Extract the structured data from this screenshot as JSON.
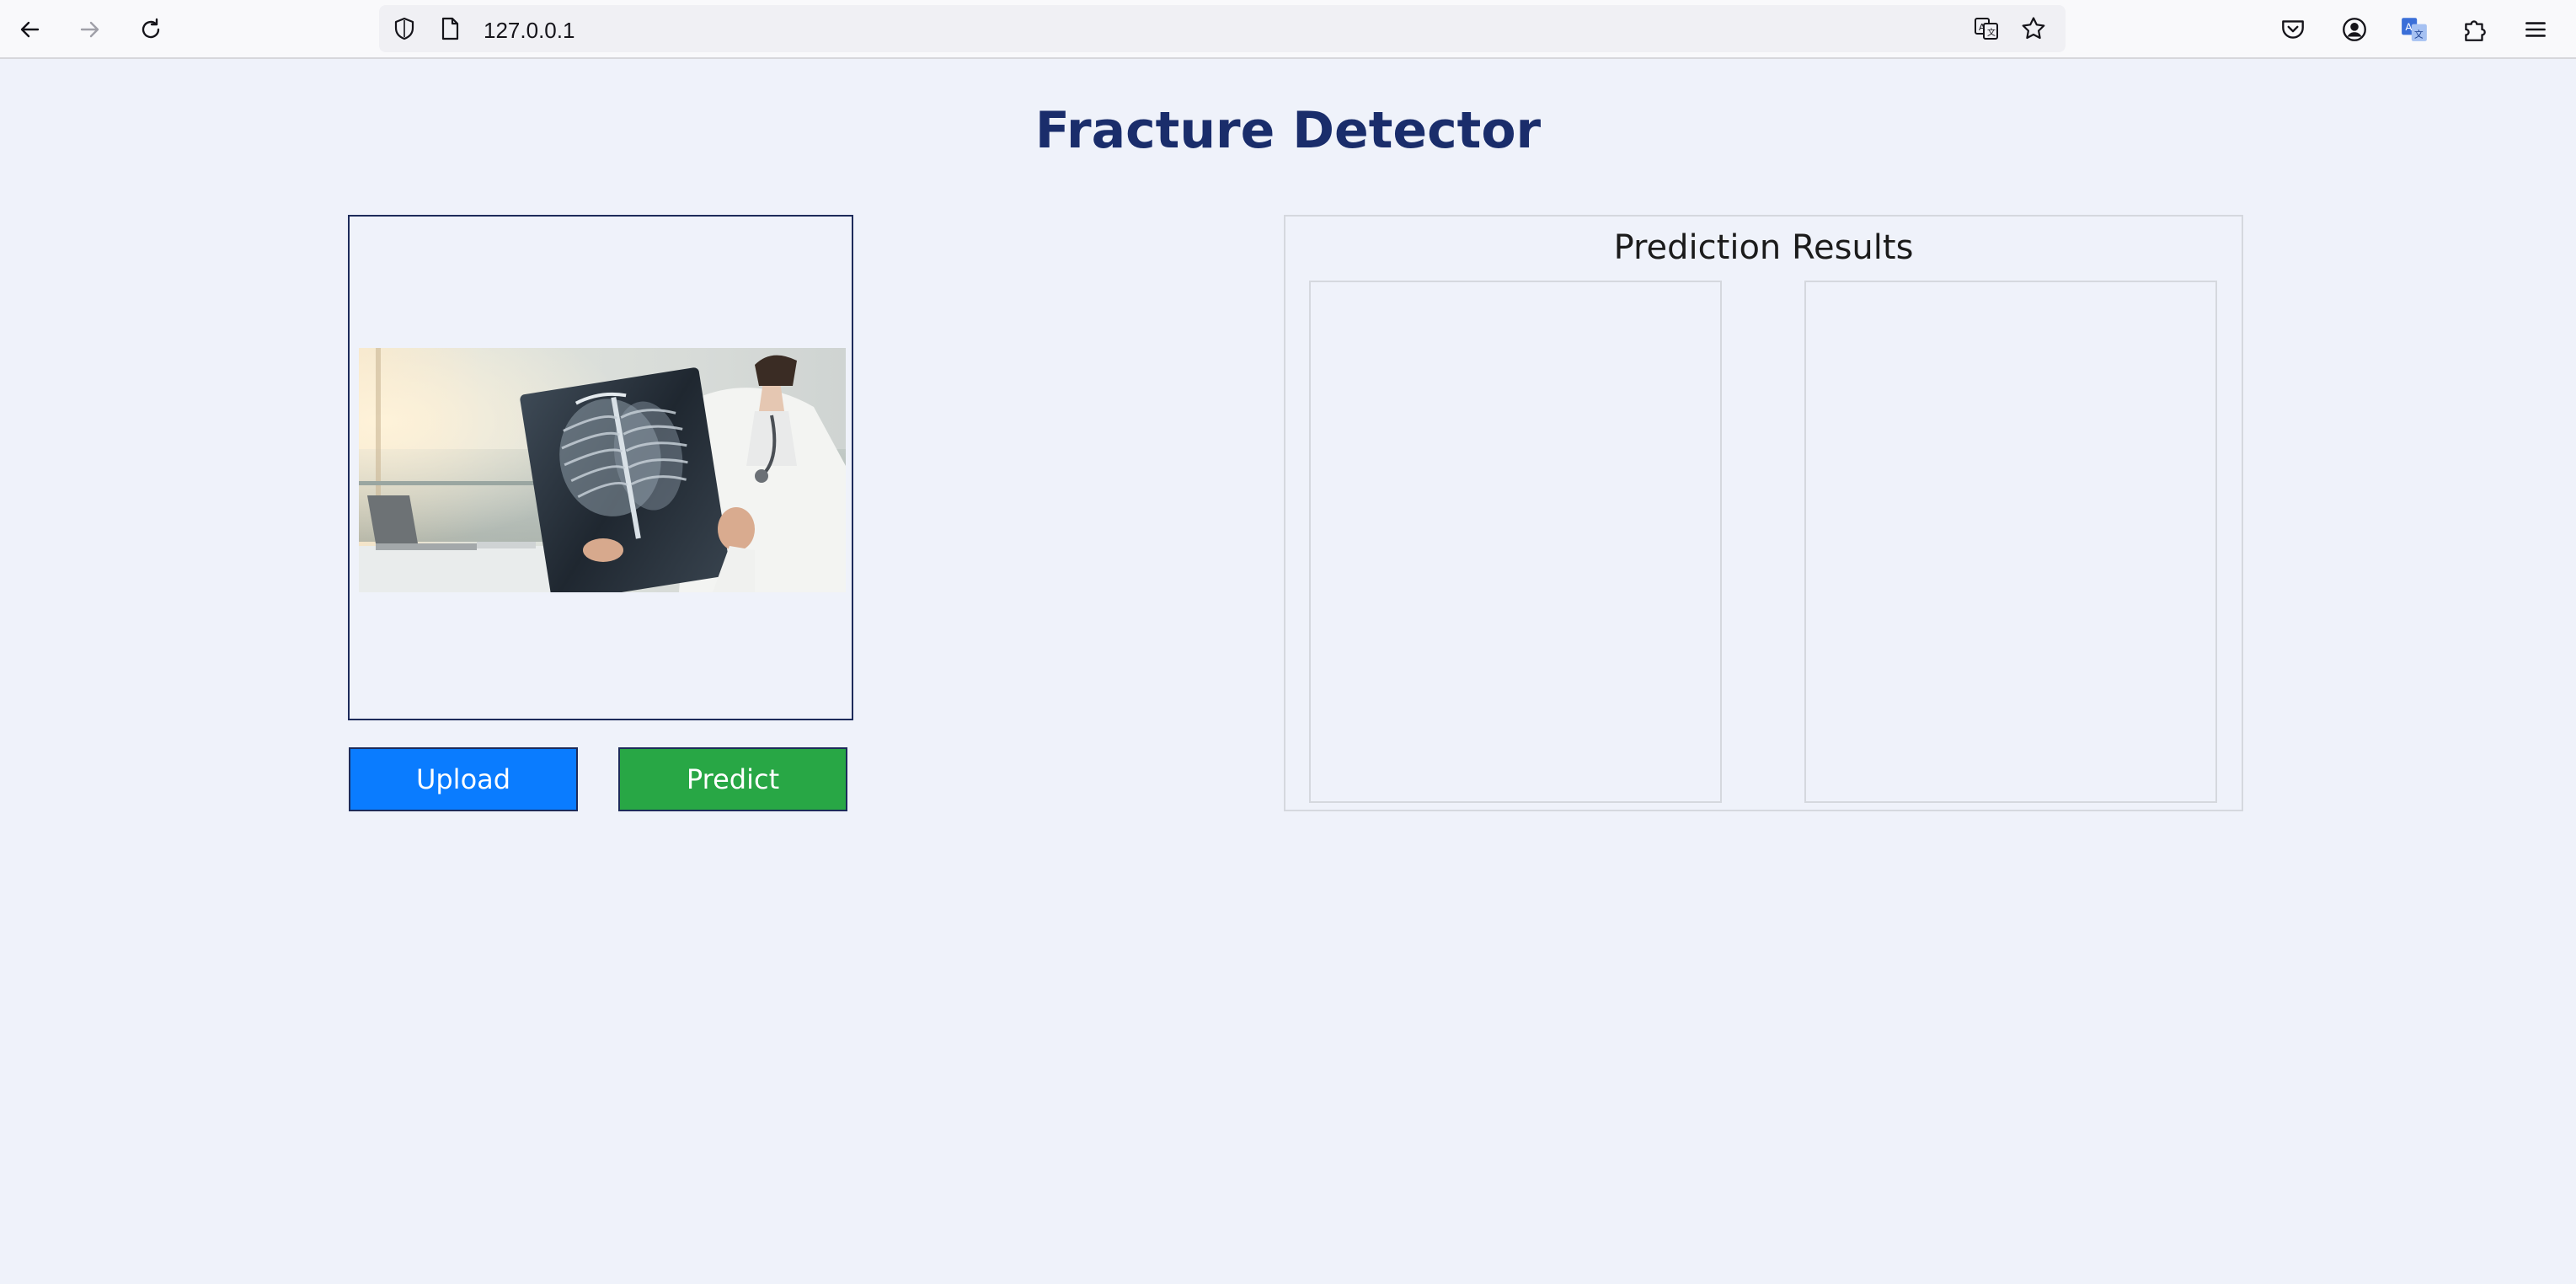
{
  "browser": {
    "url": "127.0.0.1",
    "icons": {
      "back": "back-arrow-icon",
      "forward": "forward-arrow-icon",
      "reload": "reload-icon",
      "tracking": "shield-icon",
      "page": "page-icon",
      "translate": "translate-icon",
      "bookmark": "star-icon",
      "pocket": "pocket-icon",
      "account": "account-icon",
      "translate_ext": "translate-extension-icon",
      "extensions": "puzzle-icon",
      "menu": "hamburger-menu-icon"
    }
  },
  "page": {
    "title": "Fracture Detector",
    "upload_label": "Upload",
    "predict_label": "Predict",
    "results_title": "Prediction Results"
  },
  "colors": {
    "background": "#eff2fa",
    "title": "#1a2d6b",
    "upload_button": "#0a7cff",
    "predict_button": "#28a745"
  }
}
